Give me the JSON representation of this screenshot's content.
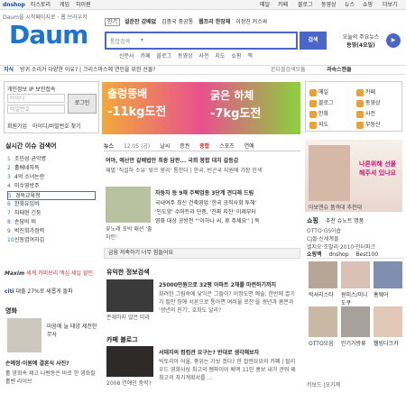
{
  "topbar": {
    "left": [
      "dnshop",
      "티스토리",
      "게임",
      "하이퀸"
    ],
    "right": [
      "메일",
      "카페",
      "블로그",
      "동영상",
      "뉴스",
      "쇼핑",
      "더보기"
    ]
  },
  "header": {
    "tagline": "Daum을 시작페이지로 · 웹 브라우저",
    "logo": "Daum",
    "search_tabs": [
      "통합",
      "뉴스",
      "블로그",
      "카페",
      "이미지",
      "동영상",
      "지식",
      "사전",
      "영화",
      "지도"
    ],
    "hot": [
      "인기",
      "설준잔 감배없",
      "김중국 중공통",
      "웹프리 한장체",
      "이정진 커스싸"
    ],
    "search_placeholder": "통합검색",
    "search_button": "검색",
    "side_text": "오늘의 주요뉴스",
    "side_link": "동영(4요일)"
  },
  "subnav": [
    "신문사",
    "카페",
    "블로그",
    "동영상",
    "사전",
    "지도",
    "쇼핑",
    "책"
  ],
  "notice": {
    "label": "지식",
    "text": "방귀 소리가 다양한 이유? | 크리스마스에 연인을 위한 선물?",
    "right": "본다블검색모듈",
    "right2": "과속스캔들"
  },
  "login": {
    "tabs": [
      "개인정보",
      "IP",
      "보안접속"
    ],
    "id_ph": "아이디",
    "pw_ph": "비밀번호",
    "button": "로그인",
    "links": [
      "회원가입",
      "아이디/비밀번호 찾기"
    ]
  },
  "issue": {
    "title": "실시간 이슈 검색어",
    "items": [
      "조민성 균악병",
      "홀베네자득",
      "4억 소녀논란",
      "미수영방주",
      "경독교육청",
      "한화유입비",
      "차태현 긴둥",
      "손담비 비",
      "박진희가정력",
      "신동엽여자김"
    ]
  },
  "ad1": {
    "brand": "Maxim",
    "text": "세계 카피브리 맥심 세일 할인"
  },
  "ad2": {
    "brand": "citi",
    "text": "대출 27%로 새롭게 돌파"
  },
  "movie": {
    "title": "영화",
    "item": "마음에 늘 태양 제천한무사",
    "sub": "손예정·이원예 결혼식 사진?",
    "desc": "홀 영화속 제고 나벤동은 바로 한 영화팔 홀벤 라이브"
  },
  "banner": {
    "left": "출렁뚱배",
    "left2": "-11kg도전",
    "right": "굵은 하체",
    "right2": "-7kg도전"
  },
  "news": {
    "tabs": [
      "뉴스",
      "날씨",
      "증권",
      "종합",
      "스포츠",
      "연예",
      "커뮤니티"
    ],
    "date": "12.05 (금)",
    "lead": "여야, 예산안 갈배법안 최종 담판... 국회 봉합 대치 갈등감",
    "lead2": "재벌 '직설하 소유' 빚으 붕리' 통한다 | 한국, 빈곤국 지원에 가장 인색",
    "cap": "차도자 등 9채 주택업종 3단계 견디래 드림",
    "item1": "자둥자 등 9채 주택업종 3단계 견디래 드림",
    "item1b": "국내여주 최신 건축영업 '한국 공직사회 투해'",
    "item1c": "'인도양' 수마트라 단층, '진짜 지진' 이제부터",
    "item1d": "영화 대상 공방전 '''이하나 씨, 휴 주세요'' | 독",
    "fashion": "꽃노래 포박 패션 '출 자인'",
    "ticker": "금융 저축하기 너무 힘들어요"
  },
  "info": {
    "title": "유익한 정보검색",
    "headline": "25000만원으로 32평 아파트 2채를 마련하기까지",
    "text": "화려한 그림속에 낮익은 그들이? 이정도면 예술, 한번에 끌기가 될만 땅에 서른으로 통아면 여러울 로잔'을 생년과 봄몬과 '생년의 친기', 호화도 달라?",
    "cap": "존재하지 않은 미라"
  },
  "blog": {
    "title": "카페 블로그",
    "headline": "서태지의 컴컴관 요구는? 반대로 생각해보자",
    "text": "빅토리아 어울, 중위는 가보 겠다? 한 잡엔요요의 카폐 | 탈리우드 영화사상 최고의 쌤파이어 베액 11인 홍보 내가 관둬 왜 최고의 자가계획서를 ...",
    "cap": "2008 연애인 중학?"
  },
  "right": {
    "menu": [
      "메일",
      "카페",
      "블로그",
      "동영상",
      "만화",
      "사전",
      "지도",
      "부동산"
    ],
    "ad": "나른위해 선물해주셔 있나요",
    "ad_cap": "아보앤슈 품격대 추천대",
    "shop_title": "쇼핑",
    "shop_tabs": [
      "추천",
      "슈노트",
      "명품"
    ],
    "shop_ads": [
      "OTTO·GS이숍",
      "CJ몰·신세계몰",
      "엘지오·조말리·2010·인터파크"
    ],
    "best": [
      "쇼핑백",
      "dnshop",
      "Best100"
    ],
    "items": [
      "럭셔리스타",
      "원피스/미니도쿠",
      "홈웨어",
      "OTTO모음",
      "인기가방류",
      "웰빙다크카"
    ],
    "bottom": "키보드 |오기계"
  },
  "colors": {
    "brand": "#1d74d1",
    "search": "#4a67c7",
    "news_red": "#d0261c"
  }
}
